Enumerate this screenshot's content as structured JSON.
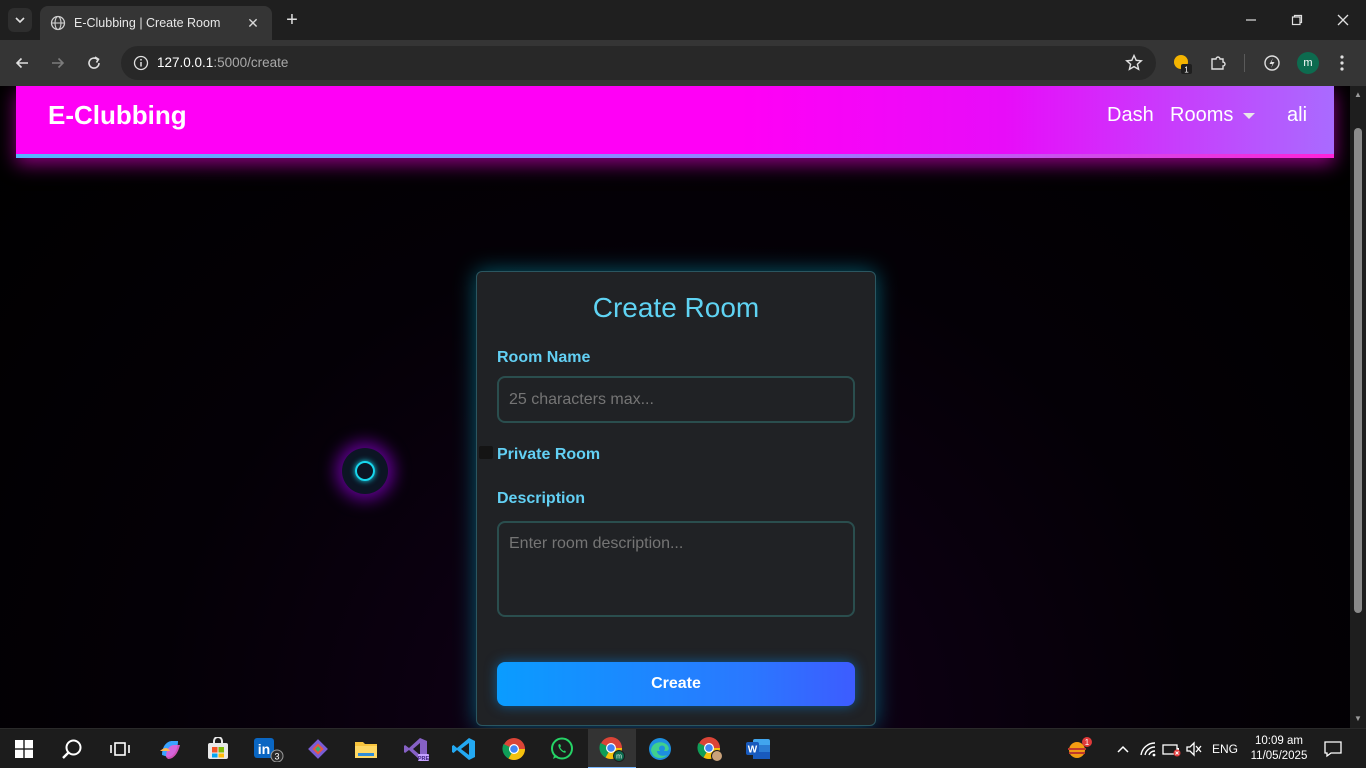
{
  "browser": {
    "tab_title": "E-Clubbing | Create Room",
    "url_host": "127.0.0.1",
    "url_path": ":5000/create",
    "extension_badge": "1",
    "profile_initial": "m"
  },
  "navbar": {
    "brand": "E-Clubbing",
    "links": {
      "dash": "Dash",
      "rooms": "Rooms",
      "user": "ali"
    }
  },
  "form": {
    "title": "Create Room",
    "room_name_label": "Room Name",
    "room_name_placeholder": "25 characters max...",
    "private_label": "Private Room",
    "description_label": "Description",
    "description_placeholder": "Enter room description...",
    "submit_label": "Create"
  },
  "taskbar": {
    "linkedin_badge": "3",
    "weather_badge": "1",
    "language": "ENG",
    "time": "10:09 am",
    "date": "11/05/2025"
  },
  "colors": {
    "navbar_start": "#ff00f6",
    "navbar_end": "#a96bff",
    "accent_cyan": "#5fd3f3",
    "button_blue": "#0a9cff"
  }
}
